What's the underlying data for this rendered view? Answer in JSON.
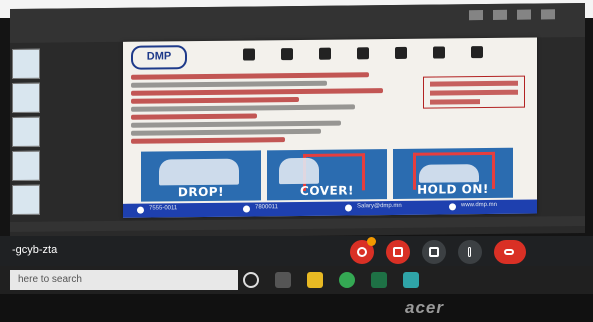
{
  "slide": {
    "brand": "DMP",
    "panels": [
      "DROP!",
      "COVER!",
      "HOLD ON!"
    ],
    "footer": [
      "7555-0011",
      "7800011",
      "Salary@dmp.mn",
      "www.dmp.mn"
    ]
  },
  "meet": {
    "code": "-gcyb-zta"
  },
  "taskbar": {
    "search_placeholder": "here to search"
  },
  "device": {
    "brand": "acer"
  },
  "colors": {
    "slide_blue": "#2b6cb0",
    "footer_blue": "#1e40af",
    "hangup_red": "#d93025"
  }
}
